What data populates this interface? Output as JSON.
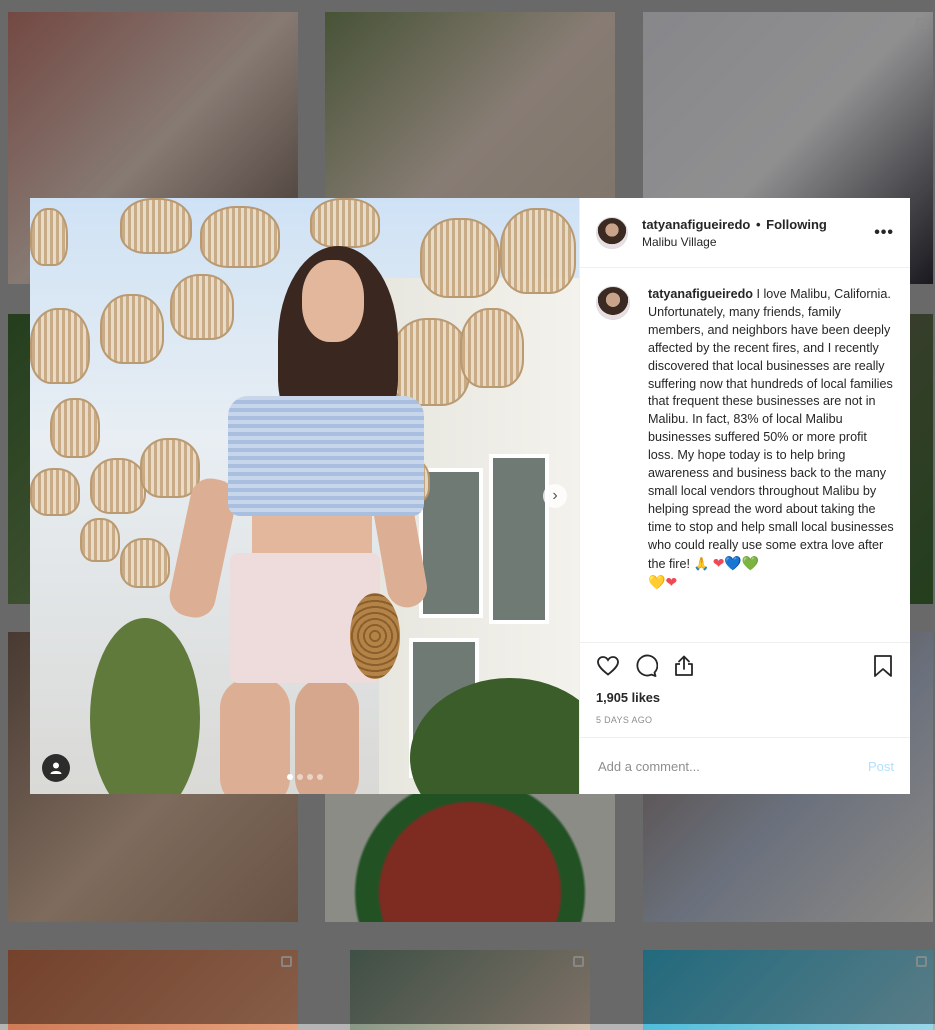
{
  "post": {
    "username": "tatyanafigueiredo",
    "separator": "•",
    "follow_status": "Following",
    "location": "Malibu Village",
    "more_icon": "more-horizontal-icon",
    "caption_username": "tatyanafigueiredo",
    "caption": "I love Malibu, California. Unfortunately, many friends, family members, and neighbors have been deeply affected by the recent fires, and I recently discovered that local businesses are really suffering now that hundreds of local families that frequent these businesses are not in Malibu. In fact, 83% of local Malibu businesses suffered 50% or more profit loss. My hope today is to help bring awareness and business back to the many small local vendors throughout Malibu by helping spread the word about taking the time to stop and help small local businesses who could really use some extra love after the fire!",
    "caption_emojis_line1": "🙏",
    "caption_hearts_line1": [
      "❤",
      "💙",
      "💚"
    ],
    "caption_hearts_line2": [
      "💛",
      "❤"
    ],
    "likes": "1,905 likes",
    "time_ago": "5 DAYS AGO",
    "comment_placeholder": "Add a comment...",
    "post_label": "Post",
    "carousel": {
      "total": 4,
      "active": 1
    },
    "colors": {
      "heart_red": "#ed4956",
      "heart_blue": "#1ea1f2",
      "heart_green": "#2ecc40",
      "heart_yellow": "#f5c518",
      "post_blue": "#b2dffc"
    }
  }
}
